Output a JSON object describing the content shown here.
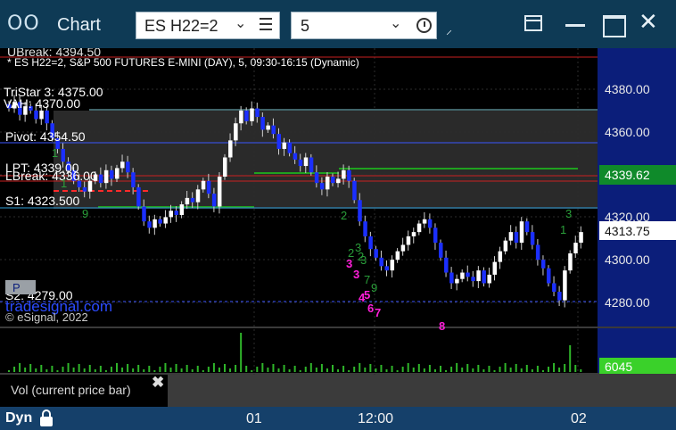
{
  "window": {
    "icon": "OO",
    "title": "Chart",
    "symbol": "ES H22=2",
    "interval": "5",
    "pin_icon": "pin-icon",
    "close_glyph": "✕"
  },
  "header": {
    "partial_top": "UBreak: 4394.50",
    "description": "* ES H22=2, S&P 500 FUTURES E-MINI (DAY), 5, 09:30-16:15 (Dynamic)"
  },
  "studies": {
    "tristar": "TriStar 3: 4375.00",
    "vah": "VAH: 4370.00",
    "pivot": "Pivot: 4354.50",
    "lpt": "LPT: 4339.00",
    "lbreak": "LBreak: 4336.00",
    "s1": "S1: 4323.500",
    "s2": "S2: 4279.00",
    "p_badge": "P",
    "trademark": "tradesignal.com",
    "copyright": "© eSignal, 2022"
  },
  "price_axis": {
    "ticks": [
      "4380.00",
      "4360.00",
      "4340.00",
      "4320.00",
      "4300.00",
      "4280.00"
    ],
    "lpt_badge": "4339.62",
    "last_price": "4313.75",
    "volume_badge": "6045"
  },
  "markers": [
    "1",
    "1",
    "9",
    "2",
    "2",
    "3",
    "3",
    "3",
    "2",
    "3",
    "7",
    "9",
    "4",
    "5",
    "6",
    "7",
    "8",
    "1",
    "3"
  ],
  "legend": {
    "vol_label": "Vol (current price bar)",
    "close": "✖"
  },
  "statusbar": {
    "mode": "Dyn",
    "time_labels": [
      "01",
      "12:00",
      "02"
    ]
  },
  "colors": {
    "title_bar": "#0e3a55",
    "price_axis": "#0b1e7a",
    "bull_candle": "#ffffff",
    "bear_candle": "#1b2fff",
    "lpt_badge": "#0f8a2a",
    "volume_badge": "#3ad12a",
    "marker_green": "#2a9f3a",
    "marker_magenta": "#ff1fd9"
  },
  "chart_data": {
    "type": "candlestick",
    "timeframe": "5",
    "y_axis_range": [
      4275,
      4395
    ],
    "levels": {
      "ubreak": 4394.5,
      "tristar3": 4375.0,
      "vah": 4370.0,
      "pivot": 4354.5,
      "lpt": 4339.0,
      "lbreak": 4336.0,
      "s1": 4323.5,
      "s2": 4279.0
    },
    "last_price": 4313.75,
    "lpt_value": 4339.62,
    "last_volume": 6045,
    "closes": [
      4371,
      4374,
      4368,
      4372,
      4370,
      4366,
      4370,
      4364,
      4357,
      4352,
      4346,
      4342,
      4337,
      4334,
      4332,
      4337,
      4340,
      4336,
      4342,
      4338,
      4343,
      4346,
      4341,
      4334,
      4325,
      4318,
      4315,
      4319,
      4317,
      4320,
      4323,
      4321,
      4326,
      4329,
      4327,
      4333,
      4337,
      4331,
      4325,
      4339,
      4348,
      4356,
      4364,
      4370,
      4365,
      4371,
      4367,
      4361,
      4363,
      4359,
      4352,
      4355,
      4350,
      4347,
      4344,
      4348,
      4341,
      4336,
      4333,
      4339,
      4336,
      4338,
      4342,
      4337,
      4328,
      4318,
      4311,
      4305,
      4301,
      4297,
      4295,
      4300,
      4304,
      4307,
      4311,
      4313,
      4317,
      4319,
      4315,
      4308,
      4301,
      4294,
      4289,
      4291,
      4294,
      4292,
      4290,
      4295,
      4289,
      4293,
      4299,
      4304,
      4309,
      4313,
      4308,
      4318,
      4313,
      4307,
      4300,
      4296,
      4289,
      4285,
      4281,
      4295,
      4303,
      4308,
      4313
    ]
  }
}
